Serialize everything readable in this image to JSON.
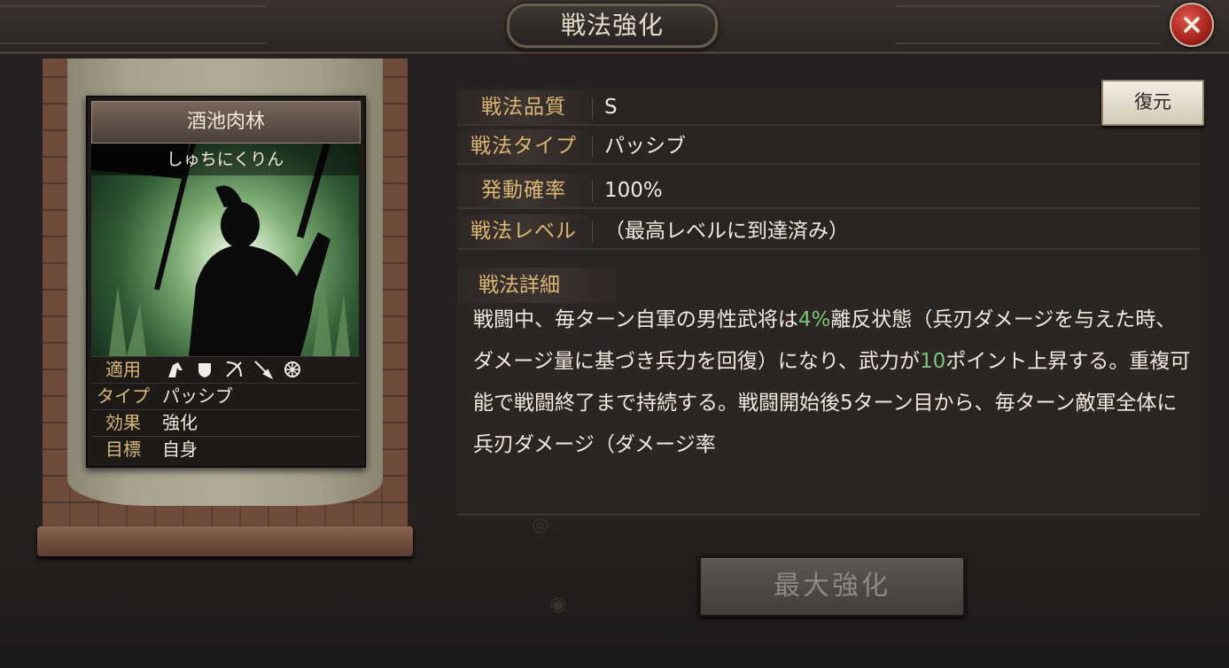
{
  "window": {
    "title": "戦法強化",
    "close_icon": "×"
  },
  "tactic_card": {
    "name": "酒池肉林",
    "reading": "しゅちにくりん",
    "rows": [
      {
        "key": "適用",
        "value": ""
      },
      {
        "key": "タイプ",
        "value": "パッシブ"
      },
      {
        "key": "効果",
        "value": "強化"
      },
      {
        "key": "目標",
        "value": "自身"
      }
    ],
    "unit_icons": [
      "cavalry-icon",
      "shield-icon",
      "bow-icon",
      "spear-icon",
      "siege-wheel-icon"
    ]
  },
  "info": {
    "rows": [
      {
        "label": "戦法品質",
        "value": "S"
      },
      {
        "label": "戦法タイプ",
        "value": "パッシブ"
      },
      {
        "label": "発動確率",
        "value": "100%"
      },
      {
        "label": "戦法レベル",
        "value": "（最高レベルに到達済み）"
      }
    ],
    "reset_button": "復元"
  },
  "detail": {
    "label": "戦法詳細",
    "t1": "戦闘中、毎ターン自軍の男性武将は",
    "hl1": "4%",
    "t2": "離反状態（兵刃ダメージを与えた時、ダメージ量に基づき兵力を回復）になり、武力が",
    "hl2": "10",
    "t3": "ポイント上昇する。重複可能で戦闘終了まで持続する。戦闘開始後5ターン目から、毎ターン敵軍全体に兵刃ダメージ（ダメージ率"
  },
  "max_enhance_button": "最大強化",
  "colors": {
    "highlight": "#7dc47a",
    "label_gold": "#dcb674",
    "close_red": "#c0342a"
  }
}
